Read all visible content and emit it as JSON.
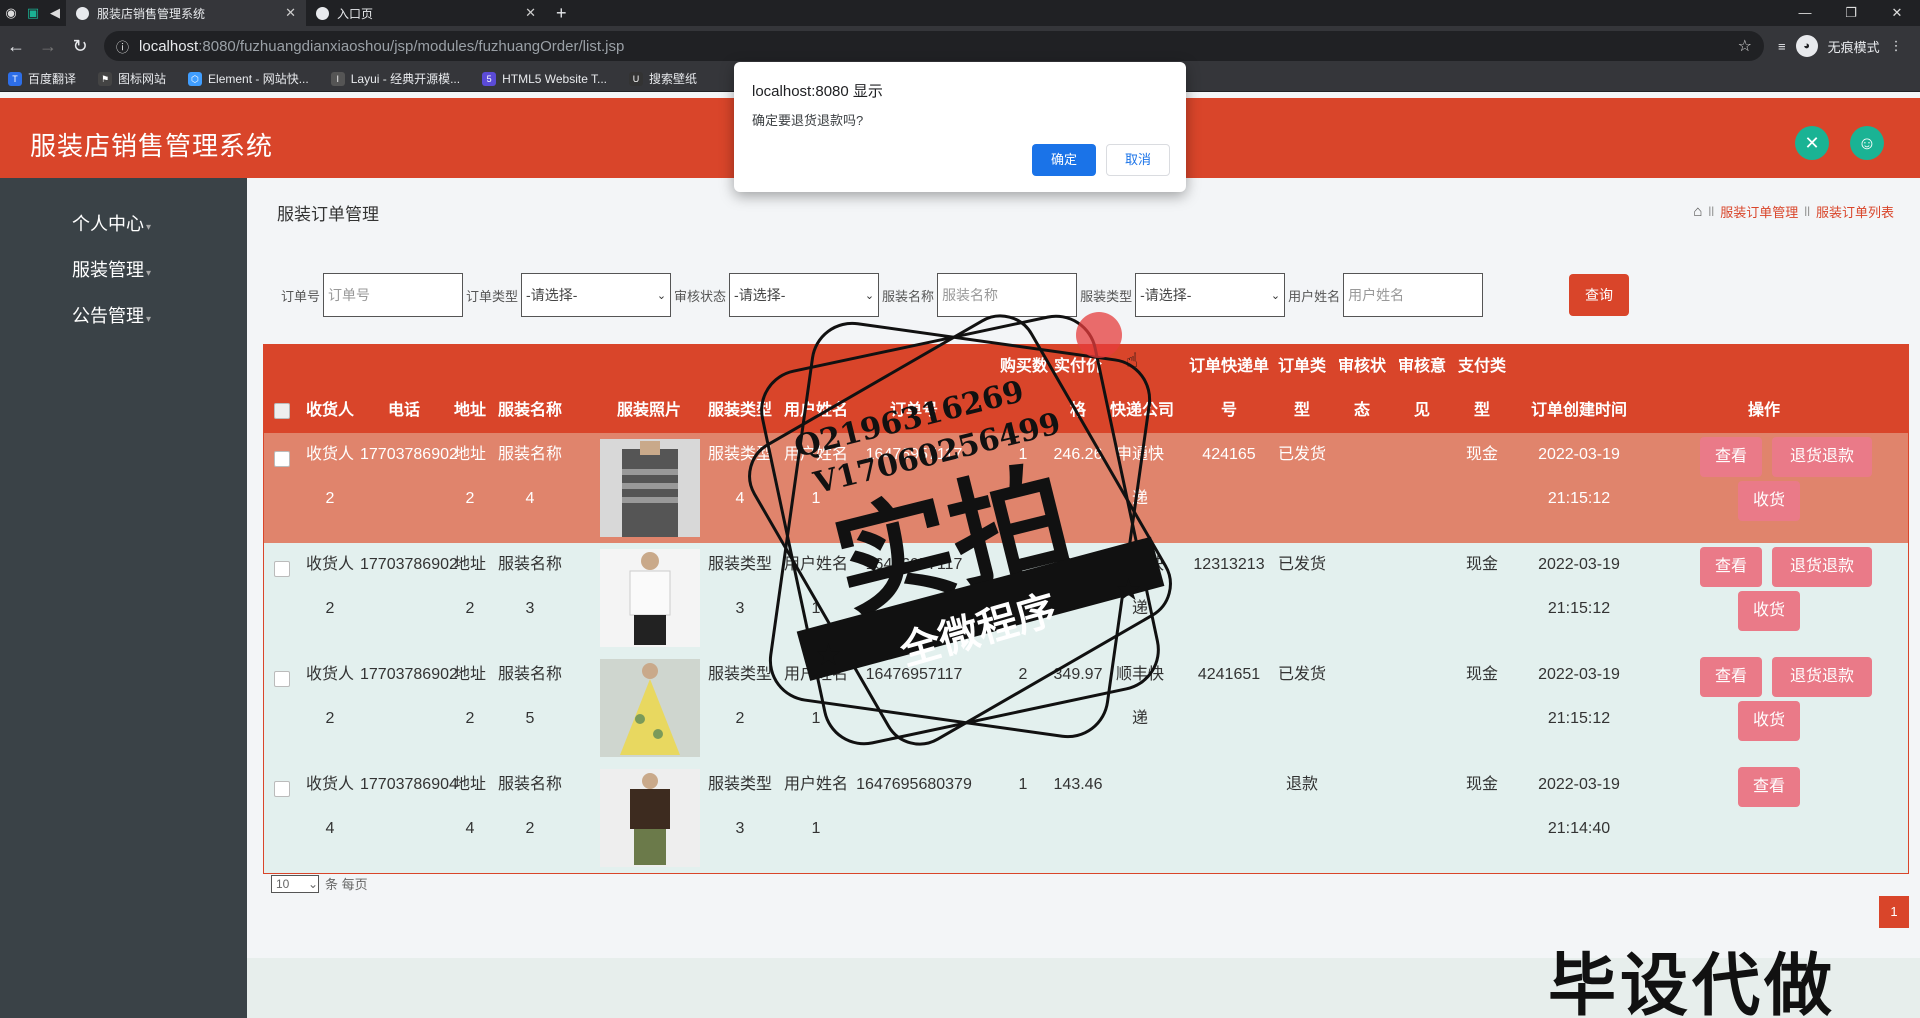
{
  "browser": {
    "tabs": [
      {
        "title": "服装店销售管理系统",
        "active": true
      },
      {
        "title": "入口页",
        "active": false
      }
    ],
    "url_host": "localhost",
    "url_path": ":8080/fuzhuangdianxiaoshou/jsp/modules/fuzhuangOrder/list.jsp",
    "incognito_label": "无痕模式",
    "bookmarks": [
      "百度翻译",
      "图标网站",
      "Element - 网站快...",
      "Layui - 经典开源模...",
      "HTML5 Website T...",
      "搜索壁纸"
    ]
  },
  "app": {
    "title": "服装店销售管理系统",
    "sidebar": [
      {
        "label": "个人中心"
      },
      {
        "label": "服装管理"
      },
      {
        "label": "公告管理"
      }
    ],
    "page_title": "服装订单管理",
    "breadcrumb": [
      "服装订单管理",
      "服装订单列表"
    ]
  },
  "search": {
    "order_no_label": "订单号",
    "order_no_placeholder": "订单号",
    "order_type_label": "订单类型",
    "order_type_value": "-请选择-",
    "audit_label": "审核状态",
    "audit_value": "-请选择-",
    "cloth_name_label": "服装名称",
    "cloth_name_placeholder": "服装名称",
    "cloth_type_label": "服装类型",
    "cloth_type_value": "-请选择-",
    "user_name_label": "用户姓名",
    "user_name_placeholder": "用户姓名",
    "query_label": "查询"
  },
  "table": {
    "headers": {
      "receiver": "收货人",
      "phone": "电话",
      "address": "地址",
      "cloth_name": "服装名称",
      "photo": "服装照片",
      "cloth_type": "服装类型",
      "user_name": "用户姓名",
      "order_no": "订单号",
      "qty": "购买数",
      "price_top": "实付价",
      "price_bot": "格",
      "express": "快递公司",
      "tracking_top": "订单快递单",
      "tracking_bot": "号",
      "otype_top": "订单类",
      "otype_bot": "型",
      "audit_top": "审核状",
      "audit_bot": "态",
      "opinion_top": "审核意",
      "opinion_bot": "见",
      "pay_top": "支付类",
      "pay_bot": "型",
      "created": "订单创建时间",
      "ops": "操作"
    },
    "rows": [
      {
        "receiver": [
          "收货人",
          "2"
        ],
        "phone": "17703786902",
        "address": [
          "地址",
          "2"
        ],
        "cloth": [
          "服装名称",
          "4"
        ],
        "ctype": [
          "服装类型",
          "4"
        ],
        "user": [
          "用户姓名",
          "1"
        ],
        "order_no": "16476957117",
        "qty": "1",
        "price": "246.26",
        "express": [
          "申通快",
          "递"
        ],
        "tracking": "424165",
        "otype": "已发货",
        "pay": "现金",
        "created": [
          "2022-03-19",
          "21:15:12"
        ],
        "btn_view": "查看",
        "btn_refund": "退货退款",
        "btn_receive": "收货"
      },
      {
        "receiver": [
          "收货人",
          "2"
        ],
        "phone": "17703786902",
        "address": [
          "地址",
          "2"
        ],
        "cloth": [
          "服装名称",
          "3"
        ],
        "ctype": [
          "服装类型",
          "3"
        ],
        "user": [
          "用户姓名",
          "1"
        ],
        "order_no": "16476957117",
        "qty": "2",
        "price": "653.82",
        "express": [
          "申通快",
          "递"
        ],
        "tracking": "12313213",
        "otype": "已发货",
        "pay": "现金",
        "created": [
          "2022-03-19",
          "21:15:12"
        ],
        "btn_view": "查看",
        "btn_refund": "退货退款",
        "btn_receive": "收货"
      },
      {
        "receiver": [
          "收货人",
          "2"
        ],
        "phone": "17703786902",
        "address": [
          "地址",
          "2"
        ],
        "cloth": [
          "服装名称",
          "5"
        ],
        "ctype": [
          "服装类型",
          "2"
        ],
        "user": [
          "用户姓名",
          "1"
        ],
        "order_no": "16476957117",
        "qty": "2",
        "price": "349.97",
        "express": [
          "顺丰快",
          "递"
        ],
        "tracking": "4241651",
        "otype": "已发货",
        "pay": "现金",
        "created": [
          "2022-03-19",
          "21:15:12"
        ],
        "btn_view": "查看",
        "btn_refund": "退货退款",
        "btn_receive": "收货"
      },
      {
        "receiver": [
          "收货人",
          "4"
        ],
        "phone": "17703786904",
        "address": [
          "地址",
          "4"
        ],
        "cloth": [
          "服装名称",
          "2"
        ],
        "ctype": [
          "服装类型",
          "3"
        ],
        "user": [
          "用户姓名",
          "1"
        ],
        "order_no": "1647695680379",
        "qty": "1",
        "price": "143.46",
        "express": [
          "",
          ""
        ],
        "tracking": "",
        "otype": "退款",
        "pay": "现金",
        "created": [
          "2022-03-19",
          "21:14:40"
        ],
        "btn_view": "查看"
      }
    ]
  },
  "pager": {
    "size": "10",
    "size_suffix": "条 每页",
    "current": "1"
  },
  "dialog": {
    "title": "localhost:8080 显示",
    "message": "确定要退货退款吗?",
    "ok": "确定",
    "cancel": "取消"
  },
  "watermark": {
    "contact1": "Q2196316269",
    "contact2": "V17060256499",
    "main": "实拍",
    "sub": "全微程序",
    "corner": "毕设代做"
  },
  "colors": {
    "header": "#d9452a",
    "sidebar": "#3a4247",
    "accent_btn": "#ea7a88",
    "row_hover": "#e0846c",
    "icon_btn": "#1ab394"
  }
}
